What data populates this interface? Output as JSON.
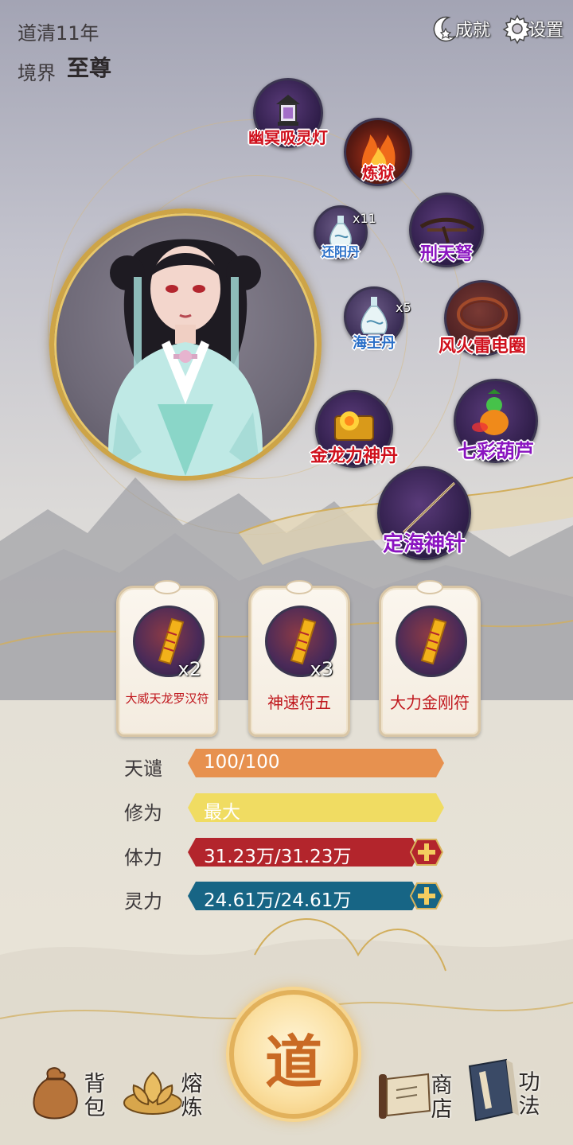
{
  "header": {
    "year": "道清11年",
    "realm_label": "境界",
    "realm_value": "至尊",
    "achievements_label": "成就",
    "settings_label": "设置"
  },
  "items": [
    {
      "name": "幽冥吸灵灯",
      "count": "",
      "name_color": "#d0101c"
    },
    {
      "name": "炼狱",
      "count": "",
      "name_color": "#d0101c"
    },
    {
      "name": "还阳丹",
      "count": "x11",
      "name_color": "#2a6fc8"
    },
    {
      "name": "刑天弩",
      "count": "",
      "name_color": "#8a14c0"
    },
    {
      "name": "海王丹",
      "count": "x5",
      "name_color": "#2a6fc8"
    },
    {
      "name": "风火雷电圈",
      "count": "",
      "name_color": "#d0101c"
    },
    {
      "name": "金龙力神丹",
      "count": "",
      "name_color": "#d0101c"
    },
    {
      "name": "七彩葫芦",
      "count": "",
      "name_color": "#8a14c0"
    },
    {
      "name": "定海神针",
      "count": "",
      "name_color": "#8a14c0"
    }
  ],
  "talismans": [
    {
      "name": "大威天龙罗汉符",
      "count": "x2"
    },
    {
      "name": "神速符五",
      "count": "x3"
    },
    {
      "name": "大力金刚符",
      "count": ""
    }
  ],
  "stats": [
    {
      "label": "天谴",
      "value": "100/100",
      "color": "#e7914f",
      "fill": 1.0
    },
    {
      "label": "修为",
      "value": "最大",
      "color": "#f0dc62"
    },
    {
      "label": "体力",
      "value": "31.23万/31.23万",
      "color": "#b3252c",
      "fill": 1.0
    },
    {
      "label": "灵力",
      "value": "24.61万/24.61万",
      "color": "#176585",
      "fill": 1.0
    }
  ],
  "nav": {
    "bag": "背包",
    "smelt": "熔炼",
    "center_glyph": "道",
    "shop": "商店",
    "skills": "功法"
  },
  "colors": {
    "gold": "#cda447",
    "accent_red": "#c0171d"
  }
}
